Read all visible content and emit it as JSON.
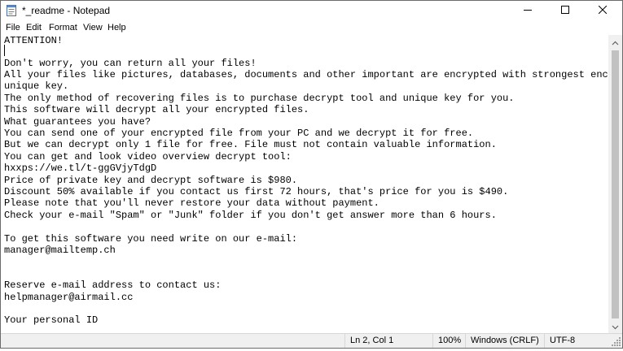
{
  "window": {
    "title": "*_readme - Notepad"
  },
  "menu": [
    "File",
    "Edit",
    "Format",
    "View",
    "Help"
  ],
  "editor": {
    "lines": [
      "ATTENTION!",
      "",
      "Don't worry, you can return all your files!",
      "All your files like pictures, databases, documents and other important are encrypted with strongest encryption and",
      "unique key.",
      "The only method of recovering files is to purchase decrypt tool and unique key for you.",
      "This software will decrypt all your encrypted files.",
      "What guarantees you have?",
      "You can send one of your encrypted file from your PC and we decrypt it for free.",
      "But we can decrypt only 1 file for free. File must not contain valuable information.",
      "You can get and look video overview decrypt tool:",
      "hxxps://we.tl/t-ggGVjyTdgD",
      "Price of private key and decrypt software is $980.",
      "Discount 50% available if you contact us first 72 hours, that's price for you is $490.",
      "Please note that you'll never restore your data without payment.",
      "Check your e-mail \"Spam\" or \"Junk\" folder if you don't get answer more than 6 hours.",
      "",
      "To get this software you need write on our e-mail:",
      "manager@mailtemp.ch",
      "",
      "",
      "Reserve e-mail address to contact us:",
      "helpmanager@airmail.cc",
      "",
      "Your personal ID"
    ]
  },
  "status": {
    "position": "Ln 2, Col 1",
    "zoom": "100%",
    "line_ending": "Windows (CRLF)",
    "encoding": "UTF-8"
  },
  "icons": {
    "app": "notepad-icon",
    "minimize": "minimize-icon",
    "maximize": "maximize-icon",
    "close": "close-icon",
    "scroll_up": "chevron-up-icon",
    "scroll_down": "chevron-down-icon",
    "grip": "resize-grip-icon"
  }
}
